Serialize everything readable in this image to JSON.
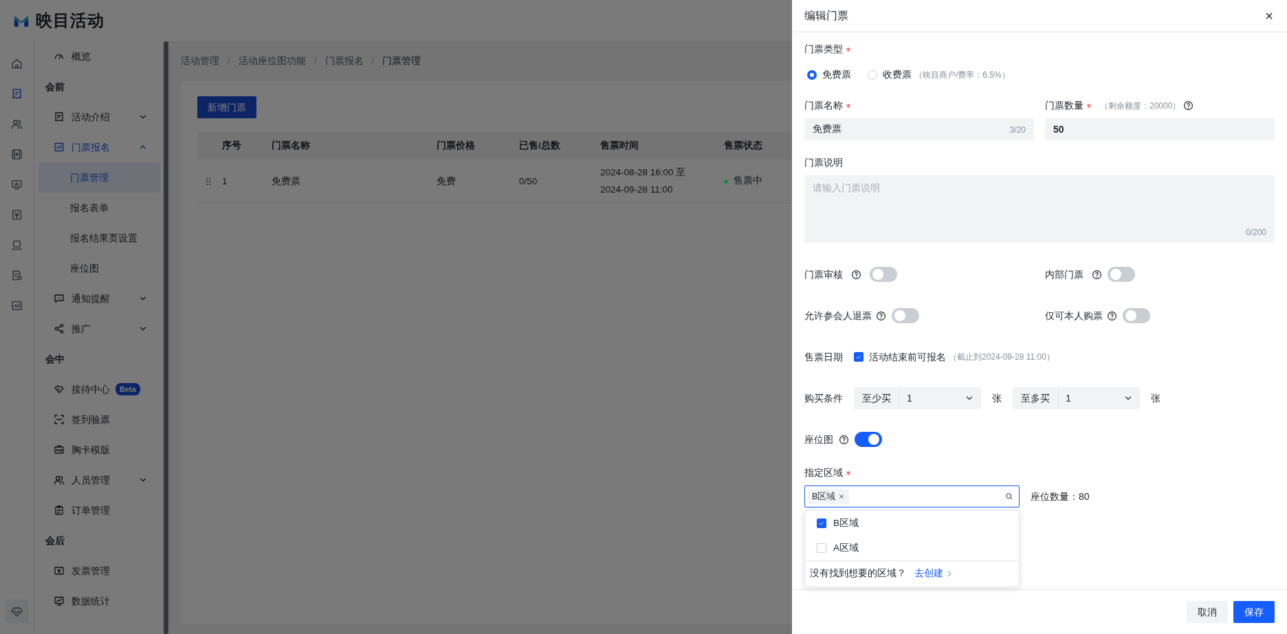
{
  "app": {
    "logo_text": "映目活动"
  },
  "icon_rail": [
    {
      "selected": false
    },
    {
      "selected": true
    },
    {
      "selected": false
    },
    {
      "selected": false
    },
    {
      "selected": false
    },
    {
      "selected": false
    },
    {
      "selected": false
    },
    {
      "selected": false
    },
    {
      "selected": false
    }
  ],
  "icon_rail_bottom": {
    "selected": false
  },
  "menu": [
    {
      "kind": "item",
      "label": "概览",
      "selected": false
    },
    {
      "kind": "group",
      "label": "会前"
    },
    {
      "kind": "item",
      "label": "活动介绍",
      "selected": false,
      "expanded": false
    },
    {
      "kind": "item",
      "label": "门票报名",
      "selected": true,
      "expanded": true,
      "children": [
        {
          "label": "门票管理",
          "selected": true
        },
        {
          "label": "报名表单",
          "selected": false
        },
        {
          "label": "报名结果页设置",
          "selected": false
        },
        {
          "label": "座位图",
          "selected": false
        }
      ]
    },
    {
      "kind": "item",
      "label": "通知提醒",
      "selected": false,
      "expanded": false
    },
    {
      "kind": "item",
      "label": "推广",
      "selected": false,
      "expanded": false
    },
    {
      "kind": "group",
      "label": "会中"
    },
    {
      "kind": "item",
      "label": "接待中心",
      "selected": false,
      "badge": "Beta"
    },
    {
      "kind": "item",
      "label": "签到验票",
      "selected": false
    },
    {
      "kind": "item",
      "label": "胸卡模版",
      "selected": false
    },
    {
      "kind": "item",
      "label": "人员管理",
      "selected": false,
      "expanded": false
    },
    {
      "kind": "item",
      "label": "订单管理",
      "selected": false
    },
    {
      "kind": "group",
      "label": "会后"
    },
    {
      "kind": "item",
      "label": "发票管理",
      "selected": false
    },
    {
      "kind": "item",
      "label": "数据统计",
      "selected": false
    }
  ],
  "breadcrumb": {
    "separator": "/",
    "items": [
      "活动管理",
      "活动座位图功能",
      "门票报名",
      "门票管理"
    ]
  },
  "add_button": "新增门票",
  "table": {
    "columns": [
      "序号",
      "门票名称",
      "门票价格",
      "已售/总数",
      "售票时间",
      "售票状态"
    ],
    "rows": [
      {
        "index": "1",
        "name": "免费票",
        "price": "免费",
        "sold": "0/50",
        "time_start": "2024-08-28 16:00 至",
        "time_end": "2024-09-28 11:00",
        "status": "售票中",
        "color": "#1d8a3e"
      }
    ]
  },
  "drawer": {
    "title": "编辑门票",
    "close": "×",
    "ticket_type": {
      "label": "门票类型",
      "required": true,
      "options": [
        {
          "label": "免费票",
          "selected": true
        },
        {
          "label": "收费票",
          "note": "（映目商户/费率：6.5%）",
          "selected": false
        }
      ]
    },
    "name_field": {
      "label": "门票名称",
      "required": true,
      "value": "免费票",
      "counter": "3/20"
    },
    "quantity_field": {
      "label": "门票数量",
      "required": true,
      "note": "（剩余额度：20000）",
      "value": "50"
    },
    "description": {
      "label": "门票说明",
      "placeholder": "请输入门票说明",
      "counter": "0/200"
    },
    "switches": [
      {
        "label": "门票审核",
        "on": false
      },
      {
        "label": "内部门票",
        "on": false
      },
      {
        "label": "允许参会人退票",
        "on": false
      },
      {
        "label": "仅可本人购票",
        "on": false
      }
    ],
    "sale_date": {
      "label": "售票日期",
      "option": "活动结束前可报名",
      "checked": true,
      "note": "（截止到2024-09-28 11:00）"
    },
    "purchase": {
      "label": "购买条件",
      "limits": [
        {
          "prefix": "至少买",
          "value": "1",
          "unit": "张"
        },
        {
          "prefix": "至多买",
          "value": "1",
          "unit": "张"
        }
      ]
    },
    "seat_map": {
      "label": "座位图",
      "on": true
    },
    "region": {
      "label": "指定区域",
      "required": true,
      "tags": [
        "B区域"
      ],
      "seat_count": "座位数量：80",
      "options": [
        {
          "label": "B区域",
          "checked": true
        },
        {
          "label": "A区域",
          "checked": false
        }
      ],
      "footer_text": "没有找到想要的区域？",
      "create_link": "去创建"
    },
    "buttons": [
      {
        "kind": "secondary",
        "label": "取消"
      },
      {
        "kind": "primary",
        "label": "保存"
      }
    ]
  }
}
